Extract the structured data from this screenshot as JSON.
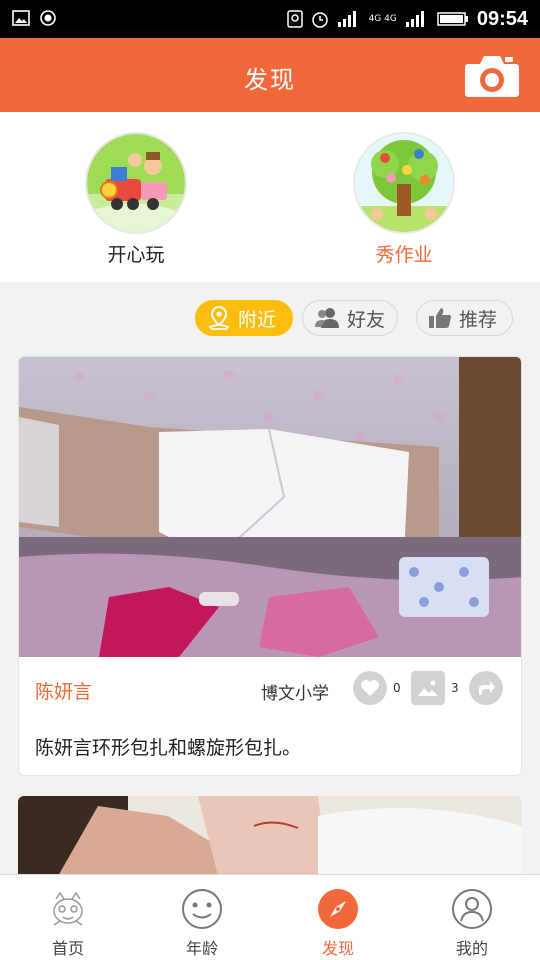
{
  "status_bar": {
    "time": "09:54",
    "network_top": "4G 4G",
    "icons": [
      "gallery-icon",
      "record-icon",
      "location-icon",
      "alarm-icon",
      "signal-icon",
      "battery-icon"
    ]
  },
  "header": {
    "title": "发现"
  },
  "entries": [
    {
      "label": "开心玩",
      "icon": "train-illustration"
    },
    {
      "label": "秀作业",
      "icon": "tree-illustration"
    }
  ],
  "filters": [
    {
      "label": "附近",
      "icon": "map-pin-icon",
      "active": true
    },
    {
      "label": "好友",
      "icon": "friends-icon",
      "active": false
    },
    {
      "label": "推荐",
      "icon": "thumbs-up-icon",
      "active": false
    }
  ],
  "post": {
    "author": "陈妍言",
    "school": "博文小学",
    "likes": "0",
    "images": "3",
    "text": "陈妍言环形包扎和螺旋形包扎。"
  },
  "nav": [
    {
      "label": "首页",
      "icon": "home-mascot-icon"
    },
    {
      "label": "年龄",
      "icon": "smiley-icon"
    },
    {
      "label": "发现",
      "icon": "compass-icon"
    },
    {
      "label": "我的",
      "icon": "user-icon"
    }
  ],
  "colors": {
    "brand": "#f1693a",
    "chip_active": "#fdbd0f",
    "icon_gray": "#d3d3d3"
  }
}
